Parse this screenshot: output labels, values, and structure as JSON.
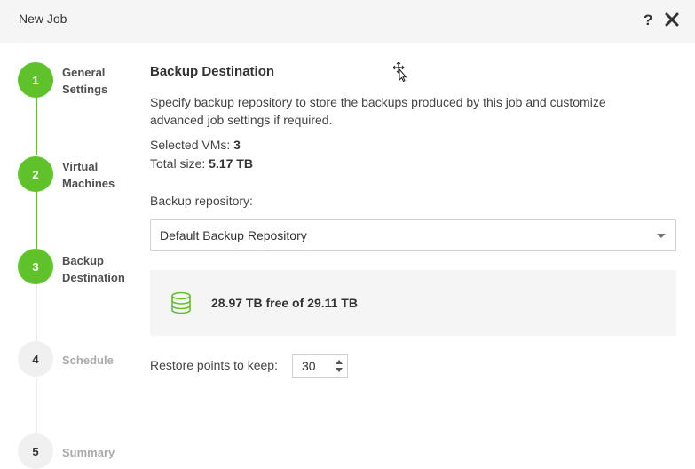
{
  "window": {
    "title": "New Job",
    "help_label": "?"
  },
  "steps": [
    {
      "number": "1",
      "label": "General\nSettings",
      "state": "complete"
    },
    {
      "number": "2",
      "label": "Virtual\nMachines",
      "state": "complete"
    },
    {
      "number": "3",
      "label": "Backup\nDestination",
      "state": "current"
    },
    {
      "number": "4",
      "label": "Schedule",
      "state": "pending"
    },
    {
      "number": "5",
      "label": "Summary",
      "state": "pending"
    }
  ],
  "main": {
    "heading": "Backup Destination",
    "description": "Specify backup repository to store the backups produced by this job and customize advanced job settings if required.",
    "selected_vms_label": "Selected VMs:",
    "selected_vms_value": "3",
    "total_size_label": "Total size:",
    "total_size_value": "5.17 TB",
    "repository_label": "Backup repository:",
    "repository_selected": "Default Backup Repository",
    "free_space_text": "28.97 TB free of 29.11 TB",
    "restore_points_label": "Restore points to keep:",
    "restore_points_value": "30"
  },
  "colors": {
    "accent": "#60c22a",
    "panel_bg": "#f5f5f5",
    "pending_step": "#aaaaaa"
  },
  "icons": {
    "close": "close-icon",
    "repository": "database-icon",
    "dropdown": "chevron-down-icon"
  }
}
